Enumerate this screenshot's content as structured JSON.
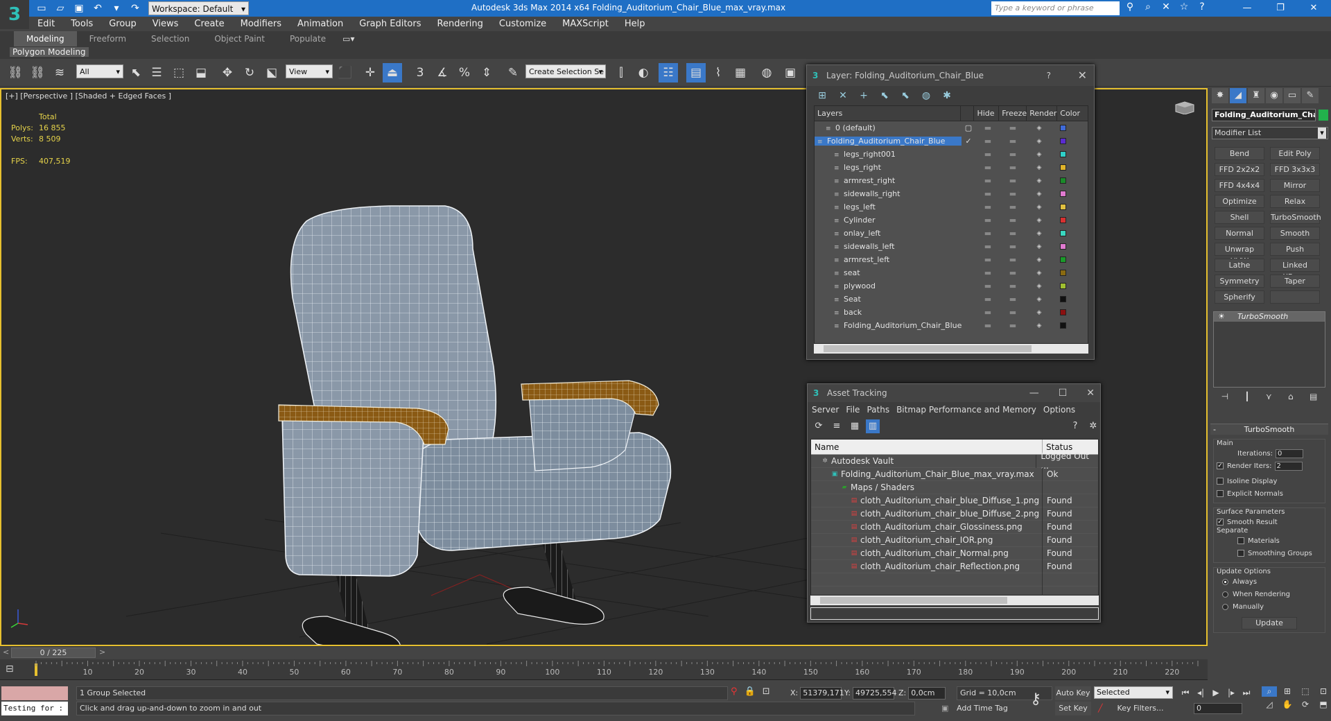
{
  "app": {
    "icon_glyph": "3",
    "title": "Autodesk 3ds Max  2014 x64      Folding_Auditorium_Chair_Blue_max_vray.max",
    "workspace": "Workspace: Default",
    "search_placeholder": "Type a keyword or phrase"
  },
  "menu": [
    "Edit",
    "Tools",
    "Group",
    "Views",
    "Create",
    "Modifiers",
    "Animation",
    "Graph Editors",
    "Rendering",
    "Customize",
    "MAXScript",
    "Help"
  ],
  "ribbon": {
    "tabs": [
      "Modeling",
      "Freeform",
      "Selection",
      "Object Paint",
      "Populate"
    ],
    "active_tab": "Modeling",
    "panel_label": "Polygon Modeling"
  },
  "toolbar": {
    "selection_filter": "All",
    "ref_coord": "View",
    "selection_set": "Create Selection Se"
  },
  "viewport": {
    "label": "[+] [Perspective ] [Shaded + Edged Faces ]",
    "stats": {
      "total_label": "Total",
      "polys_label": "Polys:",
      "polys": "16 855",
      "verts_label": "Verts:",
      "verts": "8 509",
      "fps_label": "FPS:",
      "fps": "407,519"
    }
  },
  "layer_dialog": {
    "title": "Layer: Folding_Auditorium_Chair_Blue",
    "help": "?",
    "columns": [
      "Layers",
      "Hide",
      "Freeze",
      "Render",
      "Color"
    ],
    "rows": [
      {
        "name": "0 (default)",
        "indent": 1,
        "color": "#3f6ad8",
        "current": "box"
      },
      {
        "name": "Folding_Auditorium_Chair_Blue",
        "indent": 0,
        "color": "#5a2bd0",
        "current": "check",
        "selected": true
      },
      {
        "name": "legs_right001",
        "indent": 2,
        "color": "#2fd0c8"
      },
      {
        "name": "legs_right",
        "indent": 2,
        "color": "#e0b42a"
      },
      {
        "name": "armrest_right",
        "indent": 2,
        "color": "#1a8a2a"
      },
      {
        "name": "sidewalls_right",
        "indent": 2,
        "color": "#e07ad0"
      },
      {
        "name": "legs_left",
        "indent": 2,
        "color": "#e0c040"
      },
      {
        "name": "Cylinder",
        "indent": 2,
        "color": "#d83030"
      },
      {
        "name": "onlay_left",
        "indent": 2,
        "color": "#3ad8c0"
      },
      {
        "name": "sidewalls_left",
        "indent": 2,
        "color": "#e07ad0"
      },
      {
        "name": "armrest_left",
        "indent": 2,
        "color": "#1a9a2a"
      },
      {
        "name": "seat",
        "indent": 2,
        "color": "#8a6a10"
      },
      {
        "name": "plywood",
        "indent": 2,
        "color": "#a0c030"
      },
      {
        "name": "Seat",
        "indent": 2,
        "color": "#111111"
      },
      {
        "name": "back",
        "indent": 2,
        "color": "#8a1010"
      },
      {
        "name": "Folding_Auditorium_Chair_Blue",
        "indent": 2,
        "color": "#111111"
      }
    ]
  },
  "asset_dialog": {
    "title": "Asset Tracking",
    "menu": [
      "Server",
      "File",
      "Paths",
      "Bitmap Performance and Memory",
      "Options"
    ],
    "columns": [
      "Name",
      "Status"
    ],
    "rows": [
      {
        "name": "Autodesk Vault",
        "status": "Logged Out ...",
        "indent": 1,
        "icon": "vault"
      },
      {
        "name": "Folding_Auditorium_Chair_Blue_max_vray.max",
        "status": "Ok",
        "indent": 2,
        "icon": "max-file"
      },
      {
        "name": "Maps / Shaders",
        "status": "",
        "indent": 3,
        "icon": "maps"
      },
      {
        "name": "cloth_Auditorium_chair_blue_Diffuse_1.png",
        "status": "Found",
        "indent": 4,
        "icon": "png"
      },
      {
        "name": "cloth_Auditorium_chair_blue_Diffuse_2.png",
        "status": "Found",
        "indent": 4,
        "icon": "png"
      },
      {
        "name": "cloth_Auditorium_chair_Glossiness.png",
        "status": "Found",
        "indent": 4,
        "icon": "png"
      },
      {
        "name": "cloth_Auditorium_chair_IOR.png",
        "status": "Found",
        "indent": 4,
        "icon": "png"
      },
      {
        "name": "cloth_Auditorium_chair_Normal.png",
        "status": "Found",
        "indent": 4,
        "icon": "png"
      },
      {
        "name": "cloth_Auditorium_chair_Reflection.png",
        "status": "Found",
        "indent": 4,
        "icon": "png"
      }
    ]
  },
  "command_panel": {
    "object_name": "Folding_Auditorium_Chai",
    "object_color": "#22b14c",
    "modifier_list": "Modifier List",
    "buttons": [
      "Bend",
      "Edit Poly",
      "FFD 2x2x2",
      "FFD 3x3x3",
      "FFD 4x4x4",
      "Mirror",
      "Optimize",
      "Relax",
      "Shell",
      "TurboSmooth",
      "Normal",
      "Smooth",
      "Unwrap UVW",
      "Push",
      "Lathe",
      "Linked XForm",
      "Symmetry",
      "Taper",
      "Spherify",
      ""
    ],
    "stack_item": "TurboSmooth",
    "rollout": {
      "title": "TurboSmooth",
      "main_label": "Main",
      "iterations_label": "Iterations:",
      "iterations": "0",
      "render_iters_label": "Render Iters:",
      "render_iters": "2",
      "isoline": "Isoline Display",
      "explicit_normals": "Explicit Normals",
      "surface_params": "Surface Parameters",
      "smooth_result": "Smooth Result",
      "separate": "Separate",
      "materials": "Materials",
      "smoothing_groups": "Smoothing Groups",
      "update_options": "Update Options",
      "always": "Always",
      "when_rendering": "When Rendering",
      "manually": "Manually",
      "update_button": "Update"
    }
  },
  "timeline": {
    "frame_display": "0 / 225",
    "prev": "<",
    "next": ">",
    "ticks": [
      "10",
      "20",
      "30",
      "40",
      "50",
      "60",
      "70",
      "80",
      "90",
      "100",
      "110",
      "120",
      "130",
      "140",
      "150",
      "160",
      "170",
      "180",
      "190",
      "200",
      "210",
      "220"
    ]
  },
  "status": {
    "listener_text": "Testing for :",
    "selected": "1 Group Selected",
    "prompt": "Click and drag up-and-down to zoom in and out",
    "x_label": "X:",
    "x": "51379,171",
    "y_label": "Y:",
    "y": "49725,554",
    "z_label": "Z:",
    "z": "0,0cm",
    "grid": "Grid = 10,0cm",
    "add_time_tag": "Add Time Tag",
    "auto_key": "Auto Key",
    "set_key": "Set Key",
    "key_mode": "Selected",
    "key_filters": "Key Filters...",
    "frame": "0"
  }
}
